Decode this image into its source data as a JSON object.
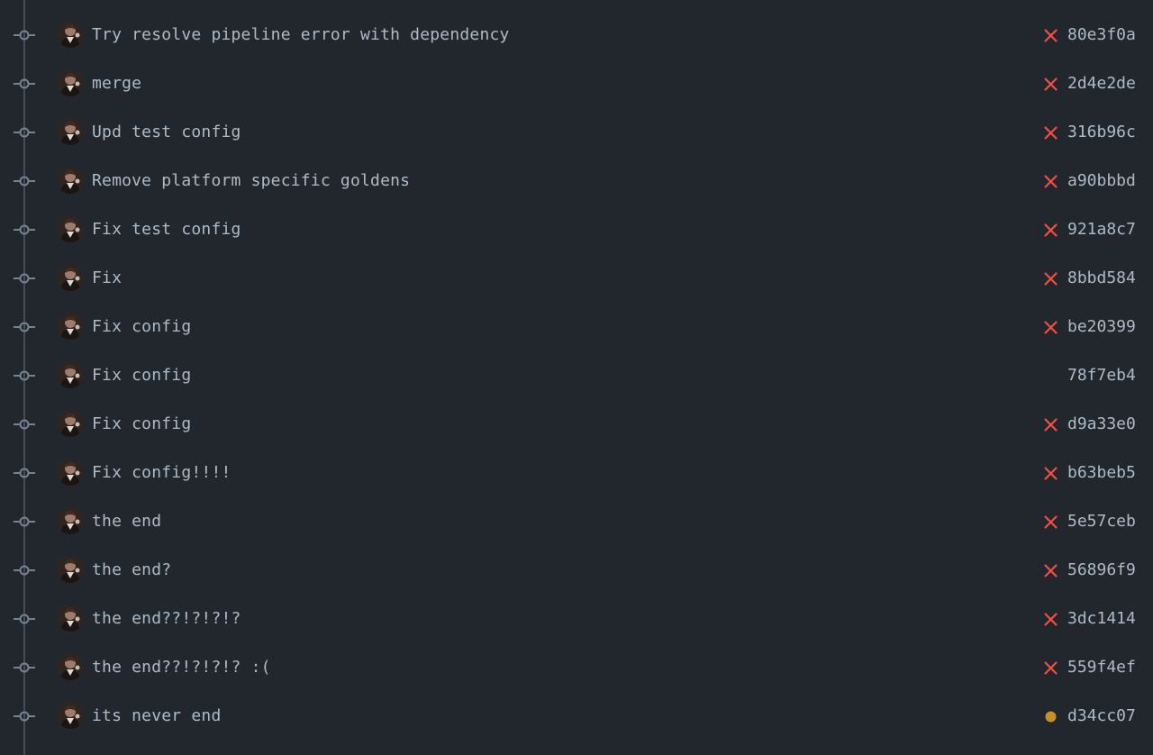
{
  "colors": {
    "background": "#22272e",
    "text": "#adbac7",
    "timeline": "#444c56",
    "node": "#768390",
    "failure": "#e5534b",
    "pending": "#c69026"
  },
  "commits": [
    {
      "message": "Try resolve pipeline error with dependency",
      "sha": "80e3f0a",
      "status": "failure",
      "status_icon": "x-icon"
    },
    {
      "message": "merge",
      "sha": "2d4e2de",
      "status": "failure",
      "status_icon": "x-icon"
    },
    {
      "message": "Upd test config",
      "sha": "316b96c",
      "status": "failure",
      "status_icon": "x-icon"
    },
    {
      "message": "Remove platform specific goldens",
      "sha": "a90bbbd",
      "status": "failure",
      "status_icon": "x-icon"
    },
    {
      "message": "Fix test config",
      "sha": "921a8c7",
      "status": "failure",
      "status_icon": "x-icon"
    },
    {
      "message": "Fix",
      "sha": "8bbd584",
      "status": "failure",
      "status_icon": "x-icon"
    },
    {
      "message": "Fix config",
      "sha": "be20399",
      "status": "failure",
      "status_icon": "x-icon"
    },
    {
      "message": "Fix config",
      "sha": "78f7eb4",
      "status": "none",
      "status_icon": ""
    },
    {
      "message": "Fix config",
      "sha": "d9a33e0",
      "status": "failure",
      "status_icon": "x-icon"
    },
    {
      "message": "Fix config!!!!",
      "sha": "b63beb5",
      "status": "failure",
      "status_icon": "x-icon"
    },
    {
      "message": "the end",
      "sha": "5e57ceb",
      "status": "failure",
      "status_icon": "x-icon"
    },
    {
      "message": "the end?",
      "sha": "56896f9",
      "status": "failure",
      "status_icon": "x-icon"
    },
    {
      "message": "the end??!?!?!?",
      "sha": "3dc1414",
      "status": "failure",
      "status_icon": "x-icon"
    },
    {
      "message": "the end??!?!?!? :(",
      "sha": "559f4ef",
      "status": "failure",
      "status_icon": "x-icon"
    },
    {
      "message": "its never end",
      "sha": "d34cc07",
      "status": "pending",
      "status_icon": "dot-icon"
    }
  ]
}
